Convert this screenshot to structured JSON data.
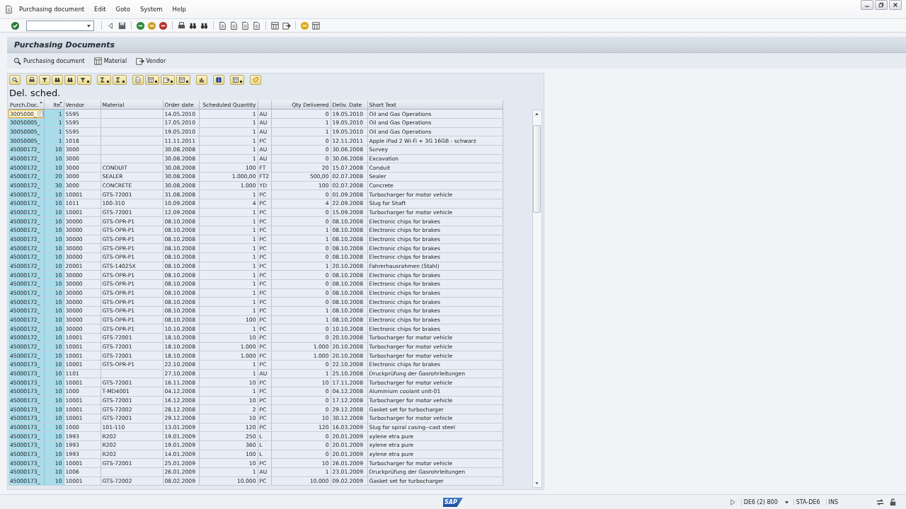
{
  "menu_bar": {
    "items": [
      "Purchasing document",
      "Edit",
      "Goto",
      "System",
      "Help"
    ]
  },
  "screen_title": "Purchasing Documents",
  "app_toolbar": [
    "Purchasing document",
    "Material",
    "Vendor"
  ],
  "list": {
    "title": "Del. sched.",
    "columns": [
      {
        "label": "Purch.Doc.",
        "kind": "key",
        "sorted": true
      },
      {
        "label": "Ite.",
        "kind": "key_number",
        "sorted": true
      },
      {
        "label": "Vendor",
        "kind": "text",
        "sorted": false
      },
      {
        "label": "Material",
        "kind": "text",
        "sorted": false
      },
      {
        "label": "Order date",
        "kind": "text",
        "sorted": false
      },
      {
        "label": "Scheduled Quantity",
        "kind": "number",
        "sorted": false
      },
      {
        "kind": "text",
        "sorted": false
      },
      {
        "label": "Qty Delivered",
        "kind": "number",
        "sorted": false
      },
      {
        "label": "Deliv. Date",
        "kind": "text",
        "sorted": false
      },
      {
        "label": "Short Text",
        "kind": "text",
        "sorted": false
      }
    ],
    "rows": [
      {
        "focused": true,
        "cells": [
          "3005000_",
          "1",
          "5595",
          "",
          "14.05.2010",
          "1",
          "AU",
          "0",
          "19.05.2010",
          "Oil and Gas Operations"
        ]
      },
      {
        "focused": false,
        "cells": [
          "30050005_",
          "1",
          "5595",
          "",
          "17.05.2010",
          "1",
          "AU",
          "1",
          "19.05.2010",
          "Oil and Gas Operations"
        ]
      },
      {
        "focused": false,
        "cells": [
          "30050005_",
          "1",
          "5595",
          "",
          "19.05.2010",
          "1",
          "AU",
          "1",
          "19.05.2010",
          "Oil and Gas Operations"
        ]
      },
      {
        "focused": false,
        "cells": [
          "30050005_",
          "1",
          "1018",
          "",
          "11.11.2011",
          "1",
          "PC",
          "0",
          "12.11.2011",
          "Apple iPad 2 Wi-Fi + 3G 16GB - schwarz"
        ]
      },
      {
        "focused": false,
        "cells": [
          "45000172_",
          "10",
          "3000",
          "",
          "30.08.2008",
          "1",
          "AU",
          "0",
          "30.06.2008",
          "Survey"
        ]
      },
      {
        "focused": false,
        "cells": [
          "45000172_",
          "10",
          "3000",
          "",
          "30.08.2008",
          "1",
          "AU",
          "0",
          "30.06.2008",
          "Excavation"
        ]
      },
      {
        "focused": false,
        "cells": [
          "45000172_",
          "10",
          "3000",
          "CONDUIT",
          "30.08.2008",
          "100",
          "FT",
          "20",
          "15.07.2008",
          "Conduit"
        ]
      },
      {
        "focused": false,
        "cells": [
          "45000172_",
          "20",
          "3000",
          "SEALER",
          "30.08.2008",
          "1.000,00",
          "FT2",
          "500,00",
          "02.07.2008",
          "Sealer"
        ]
      },
      {
        "focused": false,
        "cells": [
          "45000172_",
          "30",
          "3000",
          "CONCRETE",
          "30.08.2008",
          "1.000",
          "YD",
          "100",
          "02.07.2008",
          "Concrete"
        ]
      },
      {
        "focused": false,
        "cells": [
          "45000172_",
          "10",
          "10001",
          "GTS-72001",
          "31.08.2008",
          "1",
          "PC",
          "0",
          "01.09.2008",
          "Turbocharger for motor vehicle"
        ]
      },
      {
        "focused": false,
        "cells": [
          "45000172_",
          "10",
          "1011",
          "100-310",
          "10.09.2008",
          "4",
          "PC",
          "4",
          "22.09.2008",
          "Slug for Shaft"
        ]
      },
      {
        "focused": false,
        "cells": [
          "45000172_",
          "10",
          "10001",
          "GTS-72001",
          "12.09.2008",
          "1",
          "PC",
          "0",
          "15.09.2008",
          "Turbocharger for motor vehicle"
        ]
      },
      {
        "focused": false,
        "cells": [
          "45000172_",
          "10",
          "30000",
          "GTS-OPR-P1",
          "08.10.2008",
          "1",
          "PC",
          "0",
          "08.10.2008",
          "Electronic chips for brakes"
        ]
      },
      {
        "focused": false,
        "cells": [
          "45000172_",
          "10",
          "30000",
          "GTS-OPR-P1",
          "08.10.2008",
          "1",
          "PC",
          "1",
          "08.10.2008",
          "Electronic chips for brakes"
        ]
      },
      {
        "focused": false,
        "cells": [
          "45000172_",
          "10",
          "30000",
          "GTS-OPR-P1",
          "08.10.2008",
          "1",
          "PC",
          "1",
          "08.10.2008",
          "Electronic chips for brakes"
        ]
      },
      {
        "focused": false,
        "cells": [
          "45000172_",
          "10",
          "30000",
          "GTS-OPR-P1",
          "08.10.2008",
          "1",
          "PC",
          "0",
          "08.10.2008",
          "Electronic chips for brakes"
        ]
      },
      {
        "focused": false,
        "cells": [
          "45000172_",
          "10",
          "30000",
          "GTS-OPR-P1",
          "08.10.2008",
          "1",
          "PC",
          "0",
          "08.10.2008",
          "Electronic chips for brakes"
        ]
      },
      {
        "focused": false,
        "cells": [
          "45000172_",
          "10",
          "20001",
          "GTS-14025X",
          "08.10.2008",
          "1",
          "PC",
          "1",
          "20.10.2008",
          "Fahrerhausrahmen (Stahl)"
        ]
      },
      {
        "focused": false,
        "cells": [
          "45000172_",
          "10",
          "30000",
          "GTS-OPR-P1",
          "08.10.2008",
          "1",
          "PC",
          "0",
          "08.10.2008",
          "Electronic chips for brakes"
        ]
      },
      {
        "focused": false,
        "cells": [
          "45000172_",
          "10",
          "30000",
          "GTS-OPR-P1",
          "08.10.2008",
          "1",
          "PC",
          "0",
          "08.10.2008",
          "Electronic chips for brakes"
        ]
      },
      {
        "focused": false,
        "cells": [
          "45000172_",
          "10",
          "30000",
          "GTS-OPR-P1",
          "08.10.2008",
          "1",
          "PC",
          "0",
          "08.10.2008",
          "Electronic chips for brakes"
        ]
      },
      {
        "focused": false,
        "cells": [
          "45000172_",
          "10",
          "30000",
          "GTS-OPR-P1",
          "08.10.2008",
          "1",
          "PC",
          "0",
          "08.10.2008",
          "Electronic chips for brakes"
        ]
      },
      {
        "focused": false,
        "cells": [
          "45000172_",
          "10",
          "30000",
          "GTS-OPR-P1",
          "08.10.2008",
          "1",
          "PC",
          "1",
          "08.10.2008",
          "Electronic chips for brakes"
        ]
      },
      {
        "focused": false,
        "cells": [
          "45000172_",
          "10",
          "30000",
          "GTS-OPR-P1",
          "08.10.2008",
          "100",
          "PC",
          "1",
          "08.10.2008",
          "Electronic chips for brakes"
        ]
      },
      {
        "focused": false,
        "cells": [
          "45000172_",
          "10",
          "30000",
          "GTS-OPR-P1",
          "10.10.2008",
          "1",
          "PC",
          "0",
          "10.10.2008",
          "Electronic chips for brakes"
        ]
      },
      {
        "focused": false,
        "cells": [
          "45000172_",
          "10",
          "10001",
          "GTS-72001",
          "18.10.2008",
          "10",
          "PC",
          "0",
          "20.10.2008",
          "Turbocharger for motor vehicle"
        ]
      },
      {
        "focused": false,
        "cells": [
          "45000172_",
          "10",
          "10001",
          "GTS-72001",
          "18.10.2008",
          "1.000",
          "PC",
          "1.000",
          "20.10.2008",
          "Turbocharger for motor vehicle"
        ]
      },
      {
        "focused": false,
        "cells": [
          "45000172_",
          "10",
          "10001",
          "GTS-72001",
          "18.10.2008",
          "1.000",
          "PC",
          "1.000",
          "20.10.2008",
          "Turbocharger for motor vehicle"
        ]
      },
      {
        "focused": false,
        "cells": [
          "45000173_",
          "10",
          "10001",
          "GTS-OPR-P1",
          "22.10.2008",
          "1",
          "PC",
          "0",
          "22.10.2008",
          "Electronic chips for brakes"
        ]
      },
      {
        "focused": false,
        "cells": [
          "45000173_",
          "10",
          "1101",
          "",
          "27.10.2008",
          "1",
          "AU",
          "1",
          "25.10.2008",
          "Druckprüfung der Gasrohrleitungen"
        ]
      },
      {
        "focused": false,
        "cells": [
          "45000173_",
          "10",
          "10001",
          "GTS-72001",
          "16.11.2008",
          "10",
          "PC",
          "10",
          "17.11.2008",
          "Turbocharger for motor vehicle"
        ]
      },
      {
        "focused": false,
        "cells": [
          "45000173_",
          "10",
          "1000",
          "T-MD4001",
          "04.12.2008",
          "1",
          "PC",
          "0",
          "04.12.2008",
          "Aluminium coolant unit-01"
        ]
      },
      {
        "focused": false,
        "cells": [
          "45000173_",
          "10",
          "10001",
          "GTS-72001",
          "16.12.2008",
          "10",
          "PC",
          "0",
          "17.12.2008",
          "Turbocharger for motor vehicle"
        ]
      },
      {
        "focused": false,
        "cells": [
          "45000173_",
          "10",
          "10001",
          "GTS-72002",
          "28.12.2008",
          "2",
          "PC",
          "0",
          "29.12.2008",
          "Gasket set for turbocharger"
        ]
      },
      {
        "focused": false,
        "cells": [
          "45000173_",
          "10",
          "10001",
          "GTS-72001",
          "29.12.2008",
          "10",
          "PC",
          "10",
          "30.12.2008",
          "Turbocharger for motor vehicle"
        ]
      },
      {
        "focused": false,
        "cells": [
          "45000173_",
          "10",
          "1000",
          "101-110",
          "13.01.2009",
          "120",
          "PC",
          "120",
          "16.03.2009",
          "Slug for spiral casing--cast steel"
        ]
      },
      {
        "focused": false,
        "cells": [
          "45000173_",
          "10",
          "1993",
          "R202",
          "19.01.2009",
          "250",
          "L",
          "0",
          "20.01.2009",
          "xylene etra pure"
        ]
      },
      {
        "focused": false,
        "cells": [
          "45000173_",
          "10",
          "1993",
          "R202",
          "19.01.2009",
          "360",
          "L",
          "0",
          "20.01.2009",
          "xylene etra pure"
        ]
      },
      {
        "focused": false,
        "cells": [
          "45000173_",
          "10",
          "1993",
          "R202",
          "14.01.2009",
          "100",
          "L",
          "0",
          "20.01.2009",
          "xylene etra pure"
        ]
      },
      {
        "focused": false,
        "cells": [
          "45000173_",
          "10",
          "10001",
          "GTS-72001",
          "25.01.2009",
          "10",
          "PC",
          "10",
          "26.01.2009",
          "Turbocharger for motor vehicle"
        ]
      },
      {
        "focused": false,
        "cells": [
          "45000173_",
          "10",
          "1006",
          "",
          "26.01.2009",
          "1",
          "AU",
          "1",
          "23.01.2009",
          "Druckprüfung der Gasrohrleitungen"
        ]
      },
      {
        "focused": false,
        "cells": [
          "45000173_",
          "10",
          "10001",
          "GTS-72002",
          "08.02.2009",
          "10.000",
          "PC",
          "10.000",
          "09.02.2009",
          "Gasket set for turbocharger"
        ]
      }
    ]
  },
  "status_bar": {
    "logo": "SAP",
    "system": "DE6 (2) 800",
    "user": "STA-DE6",
    "mode": "INS"
  }
}
